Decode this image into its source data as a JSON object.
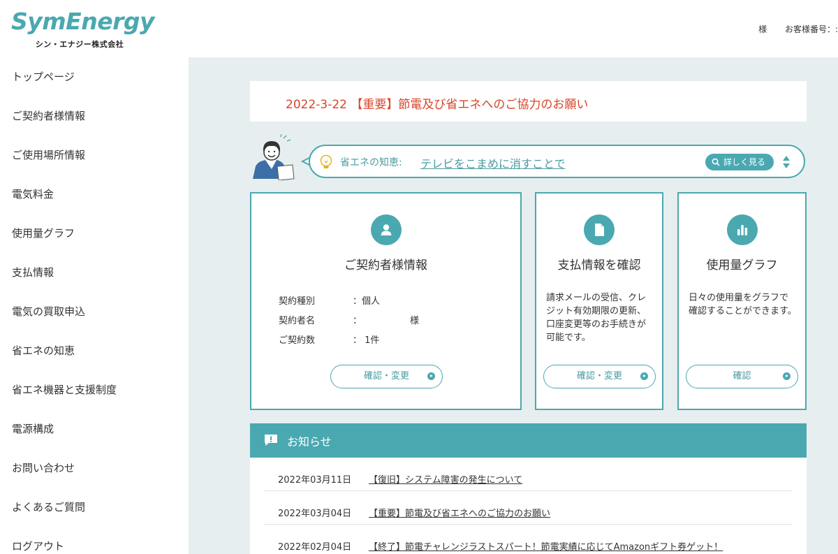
{
  "brand": {
    "logo_text": "SymEnergy",
    "company_name": "シン・エナジー株式会社"
  },
  "user": {
    "honorific": "様",
    "customer_no_label": "お客様番号：:"
  },
  "sidebar": {
    "items": [
      {
        "label": "トップページ"
      },
      {
        "label": "ご契約者様情報"
      },
      {
        "label": "ご使用場所情報"
      },
      {
        "label": "電気料金"
      },
      {
        "label": "使用量グラフ"
      },
      {
        "label": "支払情報"
      },
      {
        "label": "電気の買取申込"
      },
      {
        "label": "省エネの知恵"
      },
      {
        "label": "省エネ機器と支援制度"
      },
      {
        "label": "電源構成"
      },
      {
        "label": "お問い合わせ"
      },
      {
        "label": "よくあるご質問"
      },
      {
        "label": "ログアウト"
      }
    ]
  },
  "notice": {
    "text": "2022-3-22 【重要】節電及び省エネへのご協力のお願い",
    "color": "#d9442a"
  },
  "tip": {
    "label": "省エネの知恵:",
    "link_text": "テレビをこまめに消すことで",
    "detail_button": "詳しく見る",
    "icons": [
      "lightbulb-icon",
      "search-icon",
      "up-down-arrows-icon"
    ]
  },
  "cards": {
    "contract": {
      "title": "ご契約者様情報",
      "icon": "person-icon",
      "rows": [
        {
          "key": "契約種別",
          "value": "：個人"
        },
        {
          "key": "契約者名",
          "value": "：",
          "suffix": "様"
        },
        {
          "key": "ご契約数",
          "value": "： 1件"
        }
      ],
      "button": "確認・変更"
    },
    "payment": {
      "title": "支払情報を確認",
      "icon": "document-icon",
      "description": "請求メールの受信、クレジット有効期限の更新、口座変更等のお手続きが可能です。",
      "button": "確認・変更"
    },
    "usage": {
      "title": "使用量グラフ",
      "icon": "bar-chart-icon",
      "description": "日々の使用量をグラフで確認することができます。",
      "button": "確認"
    }
  },
  "news": {
    "title": "お知らせ",
    "items": [
      {
        "date": "2022年03月11日",
        "title": "【復旧】システム障害の発生について"
      },
      {
        "date": "2022年03月04日",
        "title": "【重要】節電及び省エネへのご協力のお願い"
      },
      {
        "date": "2022年02月04日",
        "title": "【終了】節電チャレンジラストスパート！節電実績に応じてAmazonギフト券ゲット！"
      }
    ]
  },
  "colors": {
    "accent": "#4aa8b0",
    "main_background": "#e7eeef",
    "alert": "#d9442a"
  }
}
